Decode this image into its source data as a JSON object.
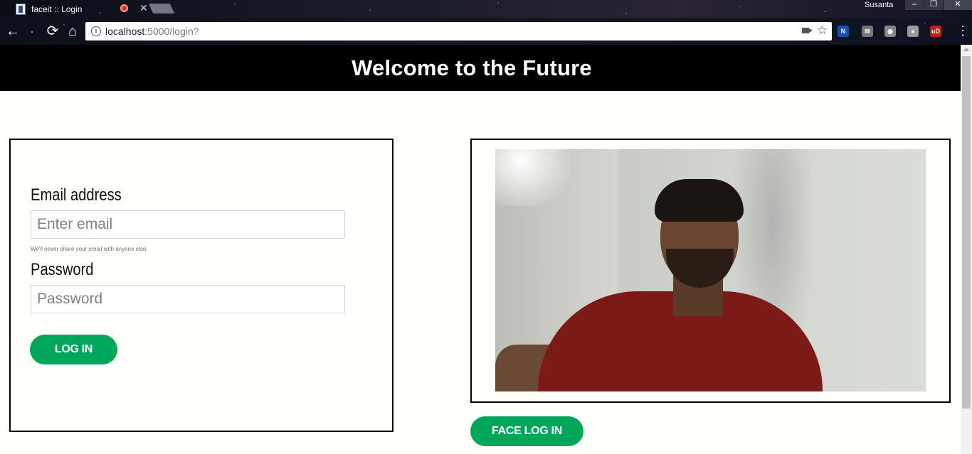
{
  "browser": {
    "tab_title": "faceit :: Login",
    "tab_close": "✕",
    "user_name": "Susanta",
    "window_controls": {
      "minimize": "–",
      "restore": "❐",
      "close": "✕"
    },
    "nav": {
      "back": "←",
      "reload": "⟳",
      "home": "⌂"
    },
    "url_host": "localhost",
    "url_path": ":5000/login?",
    "bookmark_icon": "☆",
    "menu_icon": "⋮",
    "extensions": [
      {
        "name": "n-extension-icon",
        "label": "N",
        "color": "#1a4fb3"
      },
      {
        "name": "mail-extension-icon",
        "label": "✉",
        "color": "#777777"
      },
      {
        "name": "globe-extension-icon",
        "label": "◉",
        "color": "#888888"
      },
      {
        "name": "chat-extension-icon",
        "label": "●",
        "color": "#999999"
      },
      {
        "name": "ublock-extension-icon",
        "label": "uD",
        "color": "#c91b1b"
      }
    ]
  },
  "header": {
    "title": "Welcome to the Future"
  },
  "login_form": {
    "email_label": "Email address",
    "email_placeholder": "Enter email",
    "email_help": "We'll never share your email with anyone else.",
    "password_label": "Password",
    "password_placeholder": "Password",
    "login_button": "LOG IN"
  },
  "face_login": {
    "button": "FACE LOG IN"
  },
  "colors": {
    "accent": "#00a65a",
    "header_bg": "#000000",
    "page_bg": "#fffffb"
  }
}
